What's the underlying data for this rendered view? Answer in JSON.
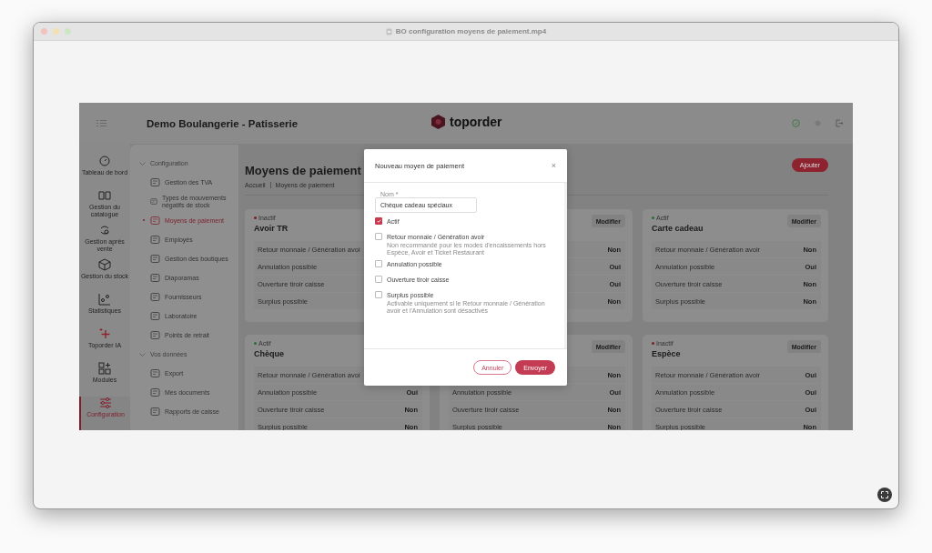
{
  "window": {
    "title": "BO configuration moyens de paiement.mp4"
  },
  "app": {
    "header": {
      "shop_name": "Demo Boulangerie - Patisserie",
      "logo_text": "toporder"
    },
    "rail": [
      {
        "label": "Tableau de bord",
        "selected": false
      },
      {
        "label": "Gestion du catalogue",
        "selected": false
      },
      {
        "label": "Gestion après vente",
        "selected": false
      },
      {
        "label": "Gestion du stock",
        "selected": false
      },
      {
        "label": "Statistiques",
        "selected": false
      },
      {
        "label": "Toporder IA",
        "selected": false
      },
      {
        "label": "Modules",
        "selected": false
      },
      {
        "label": "Configuration",
        "selected": true
      }
    ],
    "submenu": [
      {
        "kind": "section",
        "label": "Configuration"
      },
      {
        "kind": "item",
        "label": "Gestion des TVA",
        "selected": false
      },
      {
        "kind": "item",
        "label": "Types de mouvements négatifs de stock",
        "selected": false
      },
      {
        "kind": "item",
        "label": "Moyens de paiement",
        "selected": true
      },
      {
        "kind": "item",
        "label": "Employés",
        "selected": false
      },
      {
        "kind": "item",
        "label": "Gestion des boutiques",
        "selected": false
      },
      {
        "kind": "item",
        "label": "Diaporamas",
        "selected": false
      },
      {
        "kind": "item",
        "label": "Fournisseurs",
        "selected": false
      },
      {
        "kind": "item",
        "label": "Laboratoire",
        "selected": false
      },
      {
        "kind": "item",
        "label": "Points de retrait",
        "selected": false
      },
      {
        "kind": "section",
        "label": "Vos données"
      },
      {
        "kind": "item",
        "label": "Export",
        "selected": false
      },
      {
        "kind": "item",
        "label": "Mes documents",
        "selected": false
      },
      {
        "kind": "item",
        "label": "Rapports de caisse",
        "selected": false
      }
    ],
    "page": {
      "title": "Moyens de paiement",
      "breadcrumb": [
        "Accueil",
        "Moyens de paiement"
      ],
      "add_button": "Ajouter"
    },
    "cards": [
      {
        "status": "Inactif",
        "active": false,
        "title": "Avoir TR",
        "rows": [
          {
            "label": "Retour monnaie / Génération avoi"
          },
          {
            "label": "Annulation possible"
          },
          {
            "label": "Ouverture tiroir caisse"
          },
          {
            "label": "Surplus possible"
          }
        ]
      },
      {
        "edit_button": "Modifier",
        "rows": [
          {
            "value": "Non"
          },
          {
            "value": "Oui"
          },
          {
            "value": "Oui"
          },
          {
            "value": "Non"
          }
        ]
      },
      {
        "status": "Actif",
        "active": true,
        "title": "Carte cadeau",
        "edit_button": "Modifier",
        "rows": [
          {
            "label": "Retour monnaie / Génération avoir",
            "value": "Non"
          },
          {
            "label": "Annulation possible",
            "value": "Oui"
          },
          {
            "label": "Ouverture tiroir caisse",
            "value": "Non"
          },
          {
            "label": "Surplus possible",
            "value": "Non"
          }
        ]
      },
      {
        "status": "Actif",
        "active": true,
        "title": "Chèque",
        "rows": [
          {
            "label": "Retour monnaie / Génération avoi"
          },
          {
            "label": "Annulation possible",
            "value": "Oui"
          },
          {
            "label": "Ouverture tiroir caisse",
            "value": "Non"
          },
          {
            "label": "Surplus possible",
            "value": "Non"
          }
        ]
      },
      {
        "edit_button": "Modifier",
        "rows": [
          {
            "value": "Non"
          },
          {
            "label": "Annulation possible",
            "value": "Oui"
          },
          {
            "label": "Ouverture tiroir caisse",
            "value": "Non"
          },
          {
            "label": "Surplus possible",
            "value": "Non"
          }
        ]
      },
      {
        "status": "Inactif",
        "active": false,
        "title": "Espèce",
        "edit_button": "Modifier",
        "rows": [
          {
            "label": "Retour monnaie / Génération avoir",
            "value": "Oui"
          },
          {
            "label": "Annulation possible",
            "value": "Oui"
          },
          {
            "label": "Ouverture tiroir caisse",
            "value": "Oui"
          },
          {
            "label": "Surplus possible",
            "value": "Non"
          }
        ]
      }
    ],
    "modal": {
      "title": "Nouveau moyen de paiement",
      "close": "×",
      "name_field": {
        "label": "Nom *",
        "value": "Chèque cadeau spéciaux"
      },
      "options": [
        {
          "label": "Actif",
          "checked": true
        },
        {
          "label": "Retour monnaie / Génération avoir",
          "checked": false,
          "help": "Non recommandé pour les modes d'encaissements hors Espèce, Avoir et Ticket Restaurant"
        },
        {
          "label": "Annulation possible",
          "checked": false
        },
        {
          "label": "Ouverture tiroir caisse",
          "checked": false
        },
        {
          "label": "Surplus possible",
          "checked": false,
          "help": "Activable uniquement si le Retour monnaie / Génération avoir et l'Annulation sont désactivés"
        }
      ],
      "cancel_button": "Annuler",
      "submit_button": "Envoyer"
    }
  }
}
